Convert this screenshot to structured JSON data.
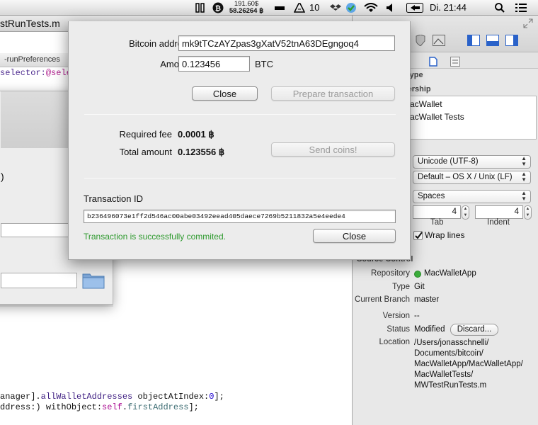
{
  "menubar": {
    "btc_top": "191.60$",
    "btc_bottom": "58.26264 ฿",
    "adobe_count": "10",
    "clock": "Di. 21:44",
    "icons": [
      "pause-icon",
      "bitcoin-icon",
      "battery-icon",
      "adobe-icon",
      "dropbox-icon",
      "wifi-icon",
      "volume-icon",
      "input-method-icon",
      "spotlight-icon",
      "notification-icon"
    ]
  },
  "editor": {
    "tab_title": "stRunTests.m",
    "jump_item": "-runPreferences",
    "code_line1_prefix": "selector:",
    "code_line1_highlight": "@sele",
    "code_line2_a": "anager].",
    "code_line2_b": "allWalletAddresses",
    "code_line2_c": " objectAtIndex:",
    "code_line2_d": "0",
    "code_line2_e": "];",
    "code_line3_a": "ddress:",
    "code_line3_b": ") ",
    "code_line3_c": "withObject:",
    "code_line3_d": "self",
    "code_line3_e": ".",
    "code_line3_f": "firstAddress",
    "code_line3_g": "];",
    "paren_fragment": ")"
  },
  "inspector": {
    "section_identity": "Identity and Type",
    "membership": "Target Membership",
    "targets": [
      "MacWallet",
      "MacWallet Tests"
    ],
    "text_encoding": "Unicode (UTF-8)",
    "line_endings": "Default – OS X / Unix (LF)",
    "indent_using": "Spaces",
    "tab_width": "4",
    "indent_width": "4",
    "tab_label": "Tab",
    "indent_label": "Indent",
    "wrap_lines": "Wrap lines",
    "source_control": "Source Control",
    "repository_label": "Repository",
    "repository_value": "MacWalletApp",
    "type_label": "Type",
    "type_value": "Git",
    "branch_label": "Current Branch",
    "branch_value": "master",
    "version_label": "Version",
    "version_value": "--",
    "status_label": "Status",
    "status_value": "Modified",
    "discard_button": "Discard...",
    "location_label": "Location",
    "location_lines": [
      "/Users/jonasschnelli/",
      "Documents/bitcoin/",
      "MacWalletApp/MacWalletApp/",
      "MacWalletTests/",
      "MWTestRunTests.m"
    ],
    "accent_color": "#3a8a2b"
  },
  "dialog": {
    "address_label": "Bitcoin address",
    "address_value": "mk9tTCzAYZpas3gXatV52tnA63DEgngoq4",
    "amount_label": "Amount",
    "amount_value": "0.123456",
    "amount_unit": "BTC",
    "close_button": "Close",
    "prepare_button": "Prepare transaction",
    "fee_label": "Required fee",
    "fee_value": "0.0001 ฿",
    "total_label": "Total amount",
    "total_value": "0.123556 ฿",
    "send_button": "Send coins!",
    "txid_label": "Transaction ID",
    "txid_value": "b236496073e1ff2d546ac00abe03492eead405daece7269b5211832a5e4eede4",
    "status_message": "Transaction is successfully commited.",
    "close_button_2": "Close",
    "status_color": "#2f9a2f"
  }
}
